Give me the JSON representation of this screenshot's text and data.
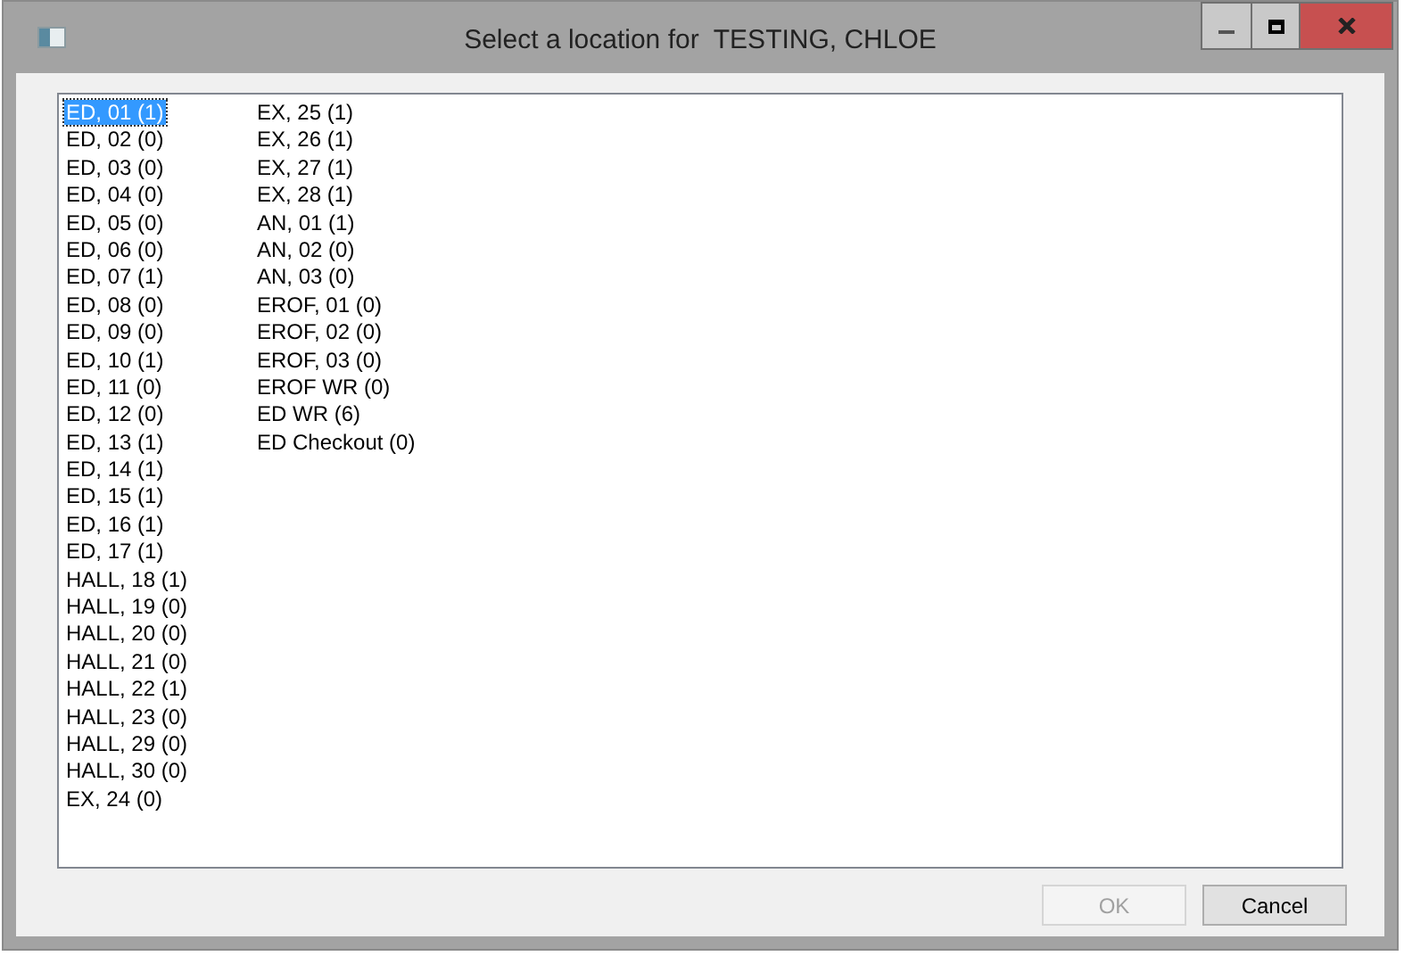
{
  "window": {
    "title": "Select a location for  TESTING, CHLOE"
  },
  "locations": [
    {
      "label": "ED, 01 (1)",
      "selected": true
    },
    {
      "label": "ED, 02 (0)",
      "selected": false
    },
    {
      "label": "ED, 03 (0)",
      "selected": false
    },
    {
      "label": "ED, 04 (0)",
      "selected": false
    },
    {
      "label": "ED, 05 (0)",
      "selected": false
    },
    {
      "label": "ED, 06 (0)",
      "selected": false
    },
    {
      "label": "ED, 07 (1)",
      "selected": false
    },
    {
      "label": "ED, 08 (0)",
      "selected": false
    },
    {
      "label": "ED, 09 (0)",
      "selected": false
    },
    {
      "label": "ED, 10 (1)",
      "selected": false
    },
    {
      "label": "ED, 11 (0)",
      "selected": false
    },
    {
      "label": "ED, 12 (0)",
      "selected": false
    },
    {
      "label": "ED, 13 (1)",
      "selected": false
    },
    {
      "label": "ED, 14 (1)",
      "selected": false
    },
    {
      "label": "ED, 15 (1)",
      "selected": false
    },
    {
      "label": "ED, 16 (1)",
      "selected": false
    },
    {
      "label": "ED, 17 (1)",
      "selected": false
    },
    {
      "label": "HALL, 18 (1)",
      "selected": false
    },
    {
      "label": "HALL, 19 (0)",
      "selected": false
    },
    {
      "label": "HALL, 20 (0)",
      "selected": false
    },
    {
      "label": "HALL, 21 (0)",
      "selected": false
    },
    {
      "label": "HALL, 22 (1)",
      "selected": false
    },
    {
      "label": "HALL, 23 (0)",
      "selected": false
    },
    {
      "label": "HALL, 29 (0)",
      "selected": false
    },
    {
      "label": "HALL, 30 (0)",
      "selected": false
    },
    {
      "label": "EX, 24 (0)",
      "selected": false
    },
    {
      "label": "EX, 25 (1)",
      "selected": false
    },
    {
      "label": "EX, 26 (1)",
      "selected": false
    },
    {
      "label": "EX, 27 (1)",
      "selected": false
    },
    {
      "label": "EX, 28 (1)",
      "selected": false
    },
    {
      "label": "AN, 01 (1)",
      "selected": false
    },
    {
      "label": "AN, 02 (0)",
      "selected": false
    },
    {
      "label": "AN, 03 (0)",
      "selected": false
    },
    {
      "label": "EROF, 01 (0)",
      "selected": false
    },
    {
      "label": "EROF, 02 (0)",
      "selected": false
    },
    {
      "label": "EROF, 03 (0)",
      "selected": false
    },
    {
      "label": "EROF WR (0)",
      "selected": false
    },
    {
      "label": "ED WR (6)",
      "selected": false
    },
    {
      "label": "ED Checkout (0)",
      "selected": false
    }
  ],
  "buttons": [
    {
      "label": "OK",
      "disabled": true
    },
    {
      "label": "Cancel",
      "disabled": false
    }
  ]
}
